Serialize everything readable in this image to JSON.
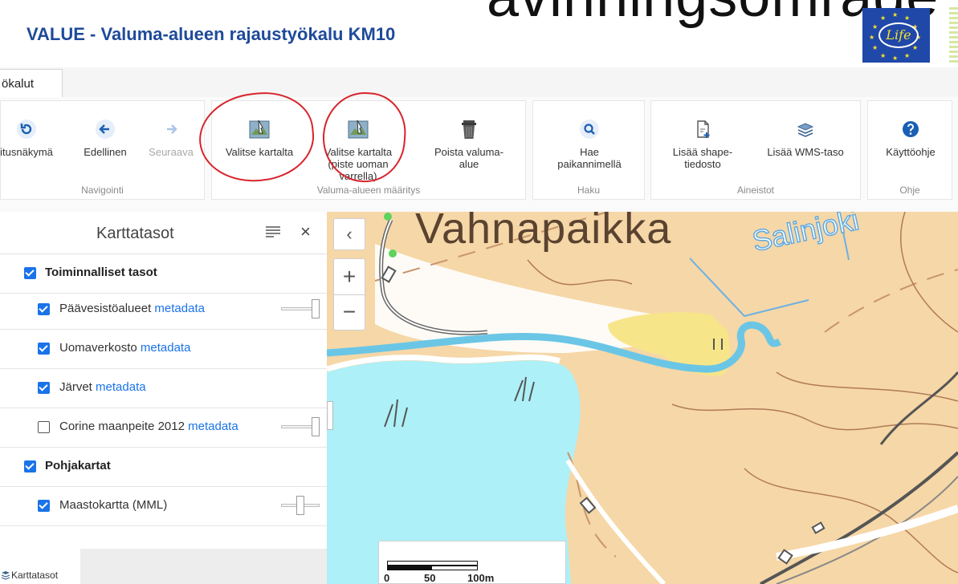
{
  "header": {
    "title": "VALUE - Valuma-alueen rajaustyökalu KM10",
    "overlay_text": "avinningsomrade",
    "logo_text": "Life"
  },
  "tabs": [
    {
      "label": "ökalut"
    }
  ],
  "ribbon": {
    "groups": [
      {
        "label": "Navigointi",
        "buttons": [
          {
            "label": "itusnäkymä",
            "icon": "refresh-icon"
          },
          {
            "label": "Edellinen",
            "icon": "arrow-left-icon"
          },
          {
            "label": "Seuraava",
            "icon": "arrow-right-icon",
            "disabled": true
          }
        ]
      },
      {
        "label": "Valuma-alueen määritys",
        "buttons": [
          {
            "label": "Valitse kartalta",
            "icon": "map-pick-icon"
          },
          {
            "label": "Valitse kartalta (piste uoman varrella)",
            "icon": "map-pick-icon"
          },
          {
            "label": "Poista valuma-alue",
            "icon": "trash-icon"
          }
        ]
      },
      {
        "label": "Haku",
        "buttons": [
          {
            "label": "Hae paikannimellä",
            "icon": "search-icon"
          }
        ]
      },
      {
        "label": "Aineistot",
        "buttons": [
          {
            "label": "Lisää shape-tiedosto",
            "icon": "add-file-icon"
          },
          {
            "label": "Lisää WMS-taso",
            "icon": "layers-add-icon"
          }
        ]
      },
      {
        "label": "Ohje",
        "buttons": [
          {
            "label": "Käyttöohje",
            "icon": "help-icon"
          }
        ]
      }
    ],
    "annotation_color": "#d8242c"
  },
  "panel": {
    "title": "Karttatasot",
    "metadata_label": "metadata",
    "groups": [
      {
        "label": "Toiminnalliset tasot",
        "checked": true,
        "layers": [
          {
            "label": "Päävesistöalueet",
            "checked": true,
            "has_metadata": true,
            "opacity": 1.0
          },
          {
            "label": "Uomaverkosto",
            "checked": true,
            "has_metadata": true
          },
          {
            "label": "Järvet",
            "checked": true,
            "has_metadata": true
          },
          {
            "label": "Corine maanpeite 2012",
            "checked": false,
            "has_metadata": true,
            "opacity": 1.0
          }
        ]
      },
      {
        "label": "Pohjakartat",
        "checked": true,
        "layers": [
          {
            "label": "Maastokartta (MML)",
            "checked": true,
            "has_metadata": false,
            "opacity": 0.5
          }
        ]
      }
    ]
  },
  "bottom": {
    "tab_label": "Karttatasot"
  },
  "map": {
    "place_name": "Vahnapaikka",
    "river_name": "Salinjoki",
    "collapse_glyph": "‹",
    "zoom_in": "+",
    "zoom_out": "−",
    "scale": {
      "labels": [
        "0",
        "50",
        "100m"
      ]
    },
    "colors": {
      "land": "#f6d7a7",
      "water": "#aef0f7",
      "river": "#6bc6e6",
      "field": "#f7e58a",
      "contour": "#b07a58",
      "road": "#666666"
    }
  },
  "accent": "#1a73e8"
}
